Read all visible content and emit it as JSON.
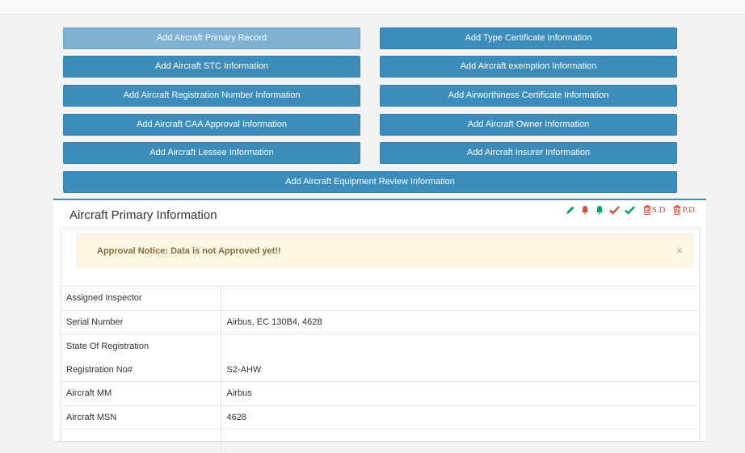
{
  "buttons": {
    "primary_record": "Add Aircraft Primary Record",
    "type_certificate": "Add Type Certificate Information",
    "stc": "Add Aircraft STC Information",
    "exemption": "Add Aircraft exemption Information",
    "registration_number": "Add Aircraft Registration Number Information",
    "airworthiness": "Add Airworthiness Certificate Information",
    "caa_approval": "Add Aircraft CAA Approval Information",
    "owner": "Add Aircraft Owner Information",
    "lessee": "Add Aircraft Lessee Information",
    "insurer": "Add Aircraft Insurer Information",
    "equipment_review": "Add Aircraft Equipment Review Information"
  },
  "panel": {
    "title": "Aircraft Primary Information",
    "tools": {
      "edit_icon": "pencil-icon",
      "alert_icon": "bell-icon",
      "notify_icon": "bell-icon",
      "approve_icon": "check-icon",
      "verify_icon": "check-icon",
      "soft_delete_label": "S.D",
      "perm_delete_label": "P.D"
    },
    "alert": {
      "text": "Approval Notice: Data is not Approved yet!!",
      "close": "×"
    },
    "rows": [
      {
        "label": "Assigned Inspector",
        "value": ""
      },
      {
        "label": "Serial Number",
        "value": "Airbus, EC 130B4, 4628"
      },
      {
        "label": "State Of Registration",
        "value": ""
      },
      {
        "label": "Registration No#",
        "value": "S2-AHW"
      },
      {
        "label": "Aircraft MM",
        "value": "Airbus"
      },
      {
        "label": "Aircraft MSN",
        "value": "4628"
      },
      {
        "label": "",
        "value": ""
      }
    ]
  },
  "colors": {
    "primary": "#3c8dbc",
    "primary_active": "#7fb1d3",
    "danger": "#dd4b39",
    "success": "#00a65a",
    "warning_bg": "#fcf8e3",
    "warning_text": "#8a6d3b"
  }
}
